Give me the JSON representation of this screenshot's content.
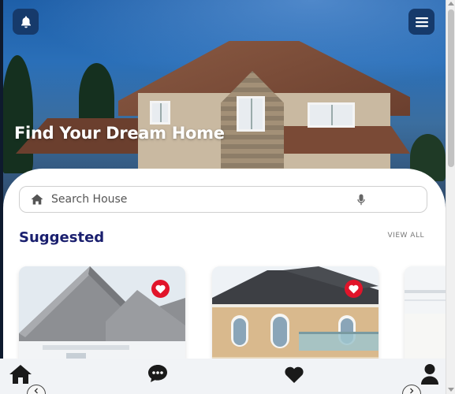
{
  "hero": {
    "title": "Find Your Dream Home"
  },
  "header": {
    "notifications_icon": "bell-icon",
    "menu_icon": "hamburger-menu-icon"
  },
  "search": {
    "placeholder": "Search House",
    "leading_icon": "home-icon",
    "trailing_icon": "microphone-icon"
  },
  "suggested": {
    "title": "Suggested",
    "view_all": "VIEW ALL",
    "cards": [
      {
        "image": "grey-roof-house-photo",
        "favorite": true
      },
      {
        "image": "cream-two-storey-house-photo",
        "favorite": true
      },
      {
        "image": "partial-house-photo",
        "favorite": false
      }
    ]
  },
  "bottom_nav": {
    "items": [
      {
        "icon": "home-icon"
      },
      {
        "icon": "chat-bubble-icon"
      },
      {
        "icon": "heart-icon"
      },
      {
        "icon": "user-icon"
      }
    ]
  },
  "colors": {
    "accent": "#1a1f6e",
    "favorite": "#e1142a",
    "header_button": "#163a6b"
  }
}
